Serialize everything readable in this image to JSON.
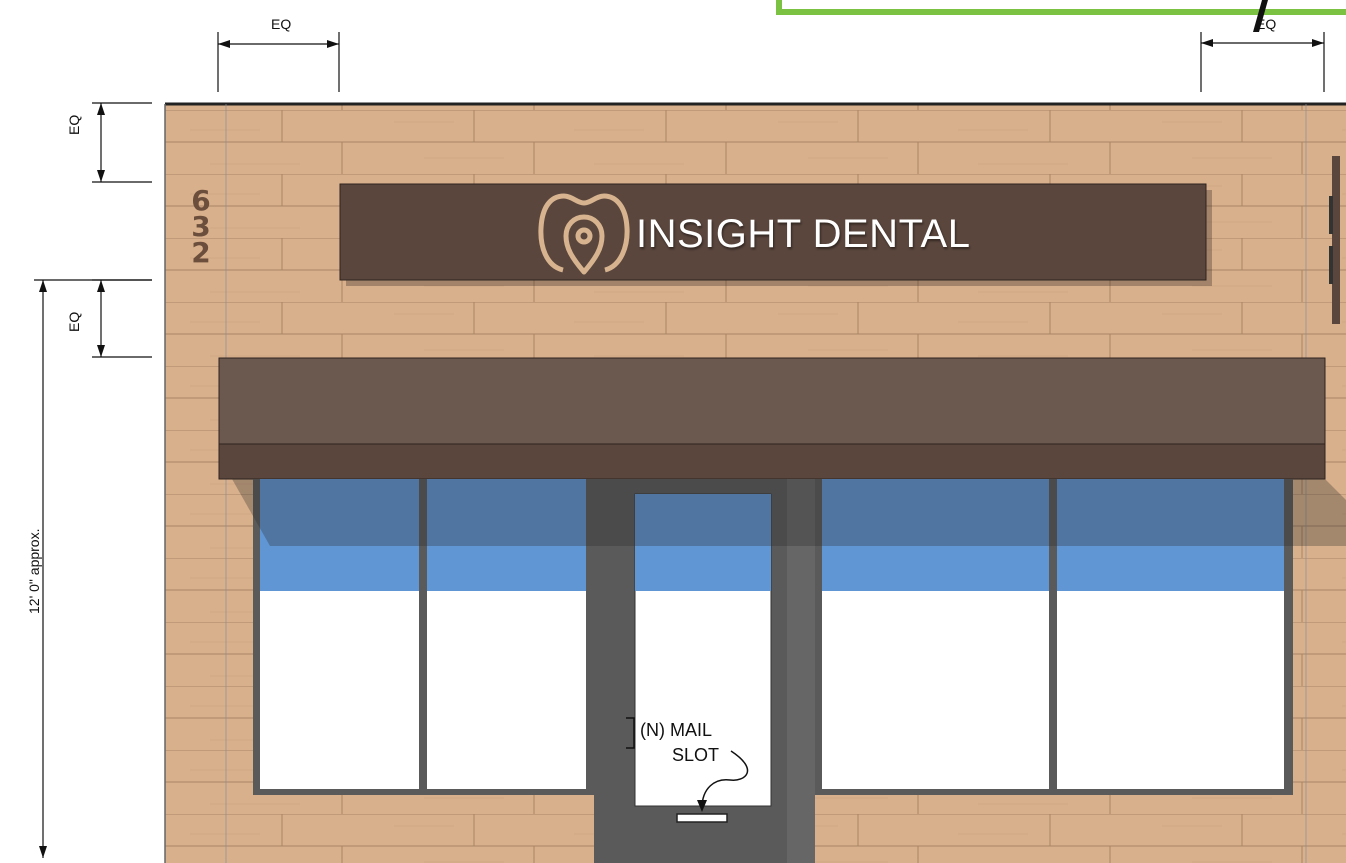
{
  "dimensions": {
    "eq_top_left": "EQ",
    "eq_top_right": "EQ",
    "eq_side_upper": "EQ",
    "eq_side_lower": "EQ",
    "height_label": "12' 0\" approx."
  },
  "building": {
    "address_digits": [
      "6",
      "3",
      "2"
    ]
  },
  "sign": {
    "text": "INSIGHT DENTAL",
    "logo_icon": "tooth-pin-icon"
  },
  "annotation": {
    "mail_slot_line1": "(N) MAIL",
    "mail_slot_line2": "SLOT"
  },
  "colors": {
    "brick": "#d9b08c",
    "sign_panel": "#5a463d",
    "awning": "#6b584f",
    "glazing_band": "#6096d4",
    "frame": "#5a5a5a",
    "logo_gold": "#d7b48f",
    "callout_frame": "#7cc242"
  }
}
